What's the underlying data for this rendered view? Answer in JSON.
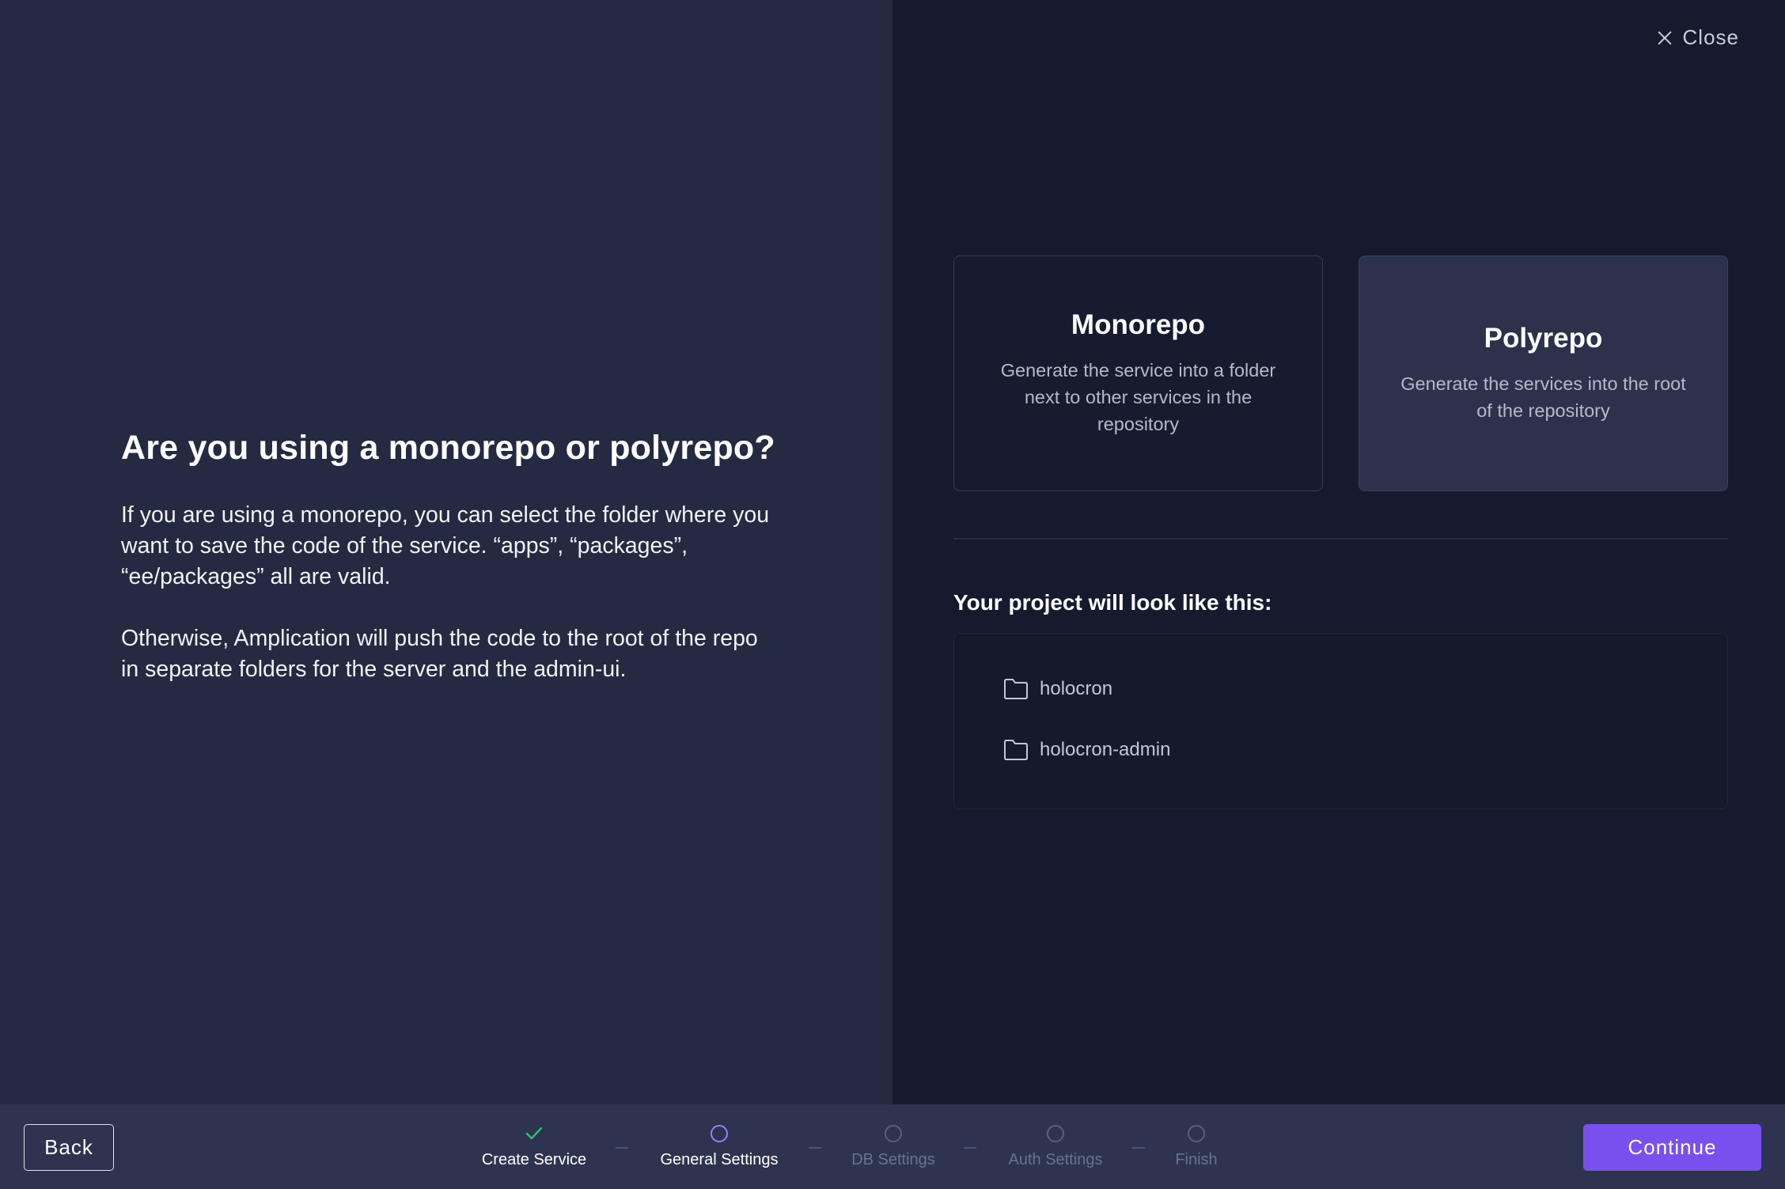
{
  "header": {
    "close_label": "Close"
  },
  "main": {
    "heading": "Are you using a monorepo or polyrepo?",
    "paragraph_1": "If you are using a monorepo, you can select the folder where you want to save the code of the service. “apps”, “packages”, “ee/packages” all are valid.",
    "paragraph_2": "Otherwise, Amplication will push the code to the root of the repo in separate folders for the server and the admin-ui."
  },
  "options": [
    {
      "title": "Monorepo",
      "description": "Generate the service into a folder next to other services in the repository"
    },
    {
      "title": "Polyrepo",
      "description": "Generate the services into the root of the repository"
    }
  ],
  "selected_option": "Polyrepo",
  "preview": {
    "title": "Your project will look like this:",
    "folders": [
      "holocron",
      "holocron-admin"
    ]
  },
  "footer": {
    "back_label": "Back",
    "continue_label": "Continue",
    "steps": [
      {
        "label": "Create Service",
        "state": "done"
      },
      {
        "label": "General Settings",
        "state": "active"
      },
      {
        "label": "DB Settings",
        "state": "pending"
      },
      {
        "label": "Auth Settings",
        "state": "pending"
      },
      {
        "label": "Finish",
        "state": "pending"
      }
    ]
  },
  "colors": {
    "accent": "#7950ed",
    "check": "#2fbf71",
    "active_step": "#9b7bff"
  }
}
